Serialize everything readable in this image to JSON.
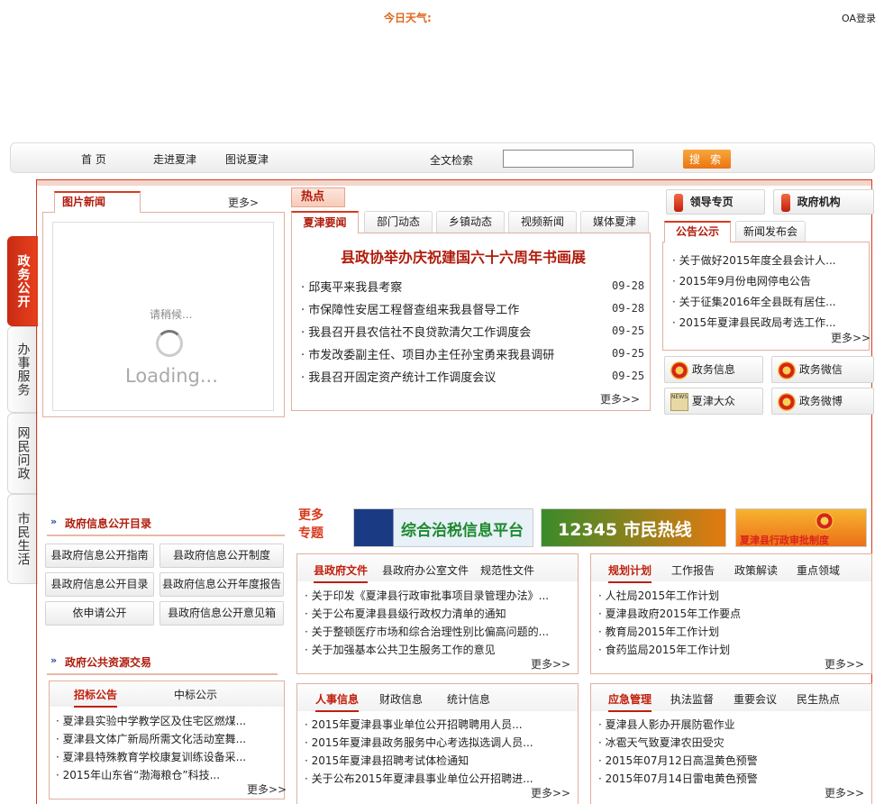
{
  "header": {
    "weather_label": "今日天气:",
    "oa_login": "OA登录"
  },
  "nav": {
    "items": [
      "首 页",
      "走进夏津",
      "图说夏津"
    ],
    "search_label": "全文检索",
    "search_value": "",
    "search_button": "搜 索"
  },
  "side_tabs": [
    "政务公开",
    "办事服务",
    "网民问政",
    "市民生活"
  ],
  "photo_news": {
    "title": "图片新闻",
    "more": "更多>",
    "loading_text": "请稍候...",
    "loading_big": "Loading..."
  },
  "hot": {
    "tag": "热点",
    "tabs": [
      "夏津要闻",
      "部门动态",
      "乡镇动态",
      "视频新闻",
      "媒体夏津"
    ],
    "headline": "县政协举办庆祝建国六十六周年书画展",
    "items": [
      {
        "title": "邱夷平来我县考察",
        "date": "09-28"
      },
      {
        "title": "市保障性安居工程督查组来我县督导工作",
        "date": "09-28"
      },
      {
        "title": "我县召开县农信社不良贷款清欠工作调度会",
        "date": "09-25"
      },
      {
        "title": "市发改委副主任、项目办主任孙宝勇来我县调研",
        "date": "09-25"
      },
      {
        "title": "我县召开固定资产统计工作调度会议",
        "date": "09-25"
      }
    ],
    "more": "更多>>"
  },
  "right_buttons": {
    "leader": "领导专页",
    "org": "政府机构"
  },
  "notice": {
    "tabs": [
      "公告公示",
      "新闻发布会"
    ],
    "items": [
      "关于做好2015年度全县会计人...",
      "2015年9月份电网停电公告",
      "关于征集2016年全县既有居住...",
      "2015年夏津县民政局考选工作..."
    ],
    "more": "更多>>"
  },
  "services": [
    "政务信息",
    "政务微信",
    "夏津大众",
    "政务微博"
  ],
  "gov_info": {
    "title": "政府信息公开目录",
    "buttons": [
      "县政府信息公开指南",
      "县政府信息公开制度",
      "县政府信息公开目录",
      "县政府信息公开年度报告",
      "依申请公开",
      "县政府信息公开意见箱"
    ]
  },
  "resource": {
    "title": "政府公共资源交易",
    "tabs": [
      "招标公告",
      "中标公示"
    ],
    "items": [
      "夏津县实验中学教学区及住宅区燃煤...",
      "夏津县文体广新局所需文化活动室舞...",
      "夏津县特殊教育学校康复训练设备采...",
      "2015年山东省“渤海粮仓”科技..."
    ],
    "more": "更多>>"
  },
  "topics": {
    "label": "更多专题",
    "banners": [
      {
        "text": "综合治税信息平台",
        "color": "#1d8a2e"
      },
      {
        "text": "12345 市民热线",
        "color": "#ffffff"
      },
      {
        "text": "夏津县行政审批制度",
        "color": "#d9261c"
      }
    ]
  },
  "docs": {
    "tabs": [
      "县政府文件",
      "县政府办公室文件",
      "规范性文件"
    ],
    "items": [
      "关于印发《夏津县行政审批事项目录管理办法》...",
      "关于公布夏津县县级行政权力清单的通知",
      "关于整顿医疗市场和综合治理性别比偏高问题的...",
      "关于加强基本公共卫生服务工作的意见"
    ],
    "more": "更多>>"
  },
  "plans": {
    "tabs": [
      "规划计划",
      "工作报告",
      "政策解读",
      "重点领域"
    ],
    "items": [
      "人社局2015年工作计划",
      "夏津县政府2015年工作要点",
      "教育局2015年工作计划",
      "食药监局2015年工作计划"
    ],
    "more": "更多>>"
  },
  "personnel": {
    "tabs": [
      "人事信息",
      "财政信息",
      "统计信息"
    ],
    "items": [
      "2015年夏津县事业单位公开招聘聘用人员...",
      "2015年夏津县政务服务中心考选拟选调人员...",
      "2015年夏津县招聘考试体检通知",
      "关于公布2015年夏津县事业单位公开招聘进..."
    ],
    "more": "更多>>"
  },
  "emergency": {
    "tabs": [
      "应急管理",
      "执法监督",
      "重要会议",
      "民生热点"
    ],
    "items": [
      "夏津县人影办开展防雹作业",
      "冰雹天气致夏津农田受灾",
      "2015年07月12日高温黄色预警",
      "2015年07月14日雷电黄色预警"
    ],
    "more": "更多>>"
  }
}
